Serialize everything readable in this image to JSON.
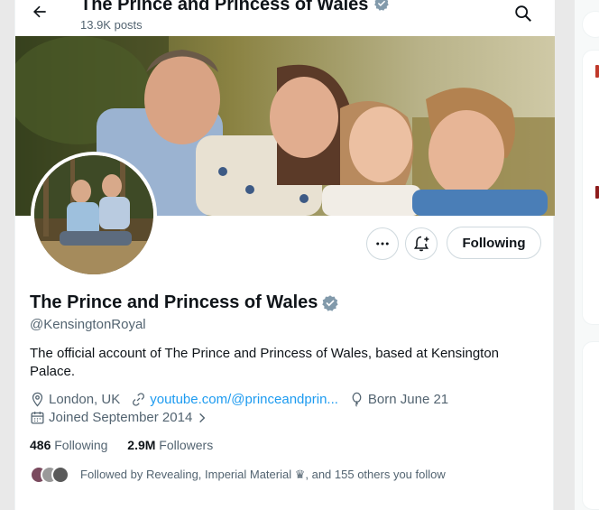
{
  "header": {
    "title": "The Prince and Princess of Wales",
    "posts": "13.9K posts"
  },
  "profile": {
    "name": "The Prince and Princess of Wales",
    "handle": "@KensingtonRoyal",
    "bio": "The official account of The Prince and Princess of Wales, based at Kensington Palace.",
    "location": "London, UK",
    "website": "youtube.com/@princeandprin...",
    "born": "Born June 21",
    "joined": "Joined September 2014",
    "following_count": "486",
    "following_label": "Following",
    "followers_count": "2.9M",
    "followers_label": "Followers",
    "followed_by": "Followed by Revealing, Imperial Material ♛, and 155 others you follow"
  },
  "buttons": {
    "follow_state": "Following"
  },
  "icons": {
    "back": "arrow-left-icon",
    "search": "search-icon",
    "more": "more-icon",
    "notify": "bell-plus-icon",
    "verified": "verified-badge-icon",
    "location": "location-pin-icon",
    "link": "link-icon",
    "born": "balloon-icon",
    "calendar": "calendar-icon"
  },
  "colors": {
    "accent": "#1d9bf0",
    "verified": "#829aab",
    "text": "#0f1419",
    "secondary": "#536471"
  }
}
